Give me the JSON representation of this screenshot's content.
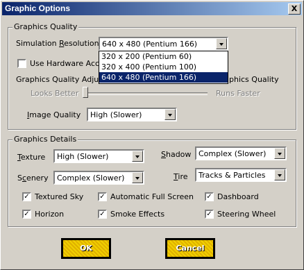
{
  "window": {
    "title": "Graphic Options",
    "close_glyph": "X"
  },
  "graphics_quality": {
    "legend": "Graphics Quality",
    "sim_res_label": "Simulation Resolution",
    "sim_res_value": "640 x 480 (Pentium 166)",
    "sim_res_options": [
      "320 x 200 (Pentium 60)",
      "320 x 400 (Pentium 100)",
      "640 x 480 (Pentium 166)"
    ],
    "hw_accel_label": "Use Hardware Acce",
    "gq_adjust_label": "Graphics Quality Adju",
    "gq_adjust_right": "phics Quality",
    "looks_better": "Looks Better",
    "runs_faster": "Runs Faster",
    "slider_value": 0,
    "image_quality_label": "Image Quality",
    "image_quality_value": "High (Slower)"
  },
  "graphics_details": {
    "legend": "Graphics Details",
    "texture_label": "Texture",
    "texture_value": "High (Slower)",
    "shadow_label": "Shadow",
    "shadow_value": "Complex (Slower)",
    "scenery_label": "Scenery",
    "scenery_value": "Complex (Slower)",
    "tire_label": "Tire",
    "tire_value": "Tracks & Particles",
    "checks": {
      "textured_sky": "Textured Sky",
      "automatic_full_screen": "Automatic Full Screen",
      "dashboard": "Dashboard",
      "horizon": "Horizon",
      "smoke_effects": "Smoke Effects",
      "steering_wheel": "Steering Wheel"
    },
    "check_glyph": "✓"
  },
  "buttons": {
    "ok": "OK",
    "cancel": "Cancel"
  }
}
